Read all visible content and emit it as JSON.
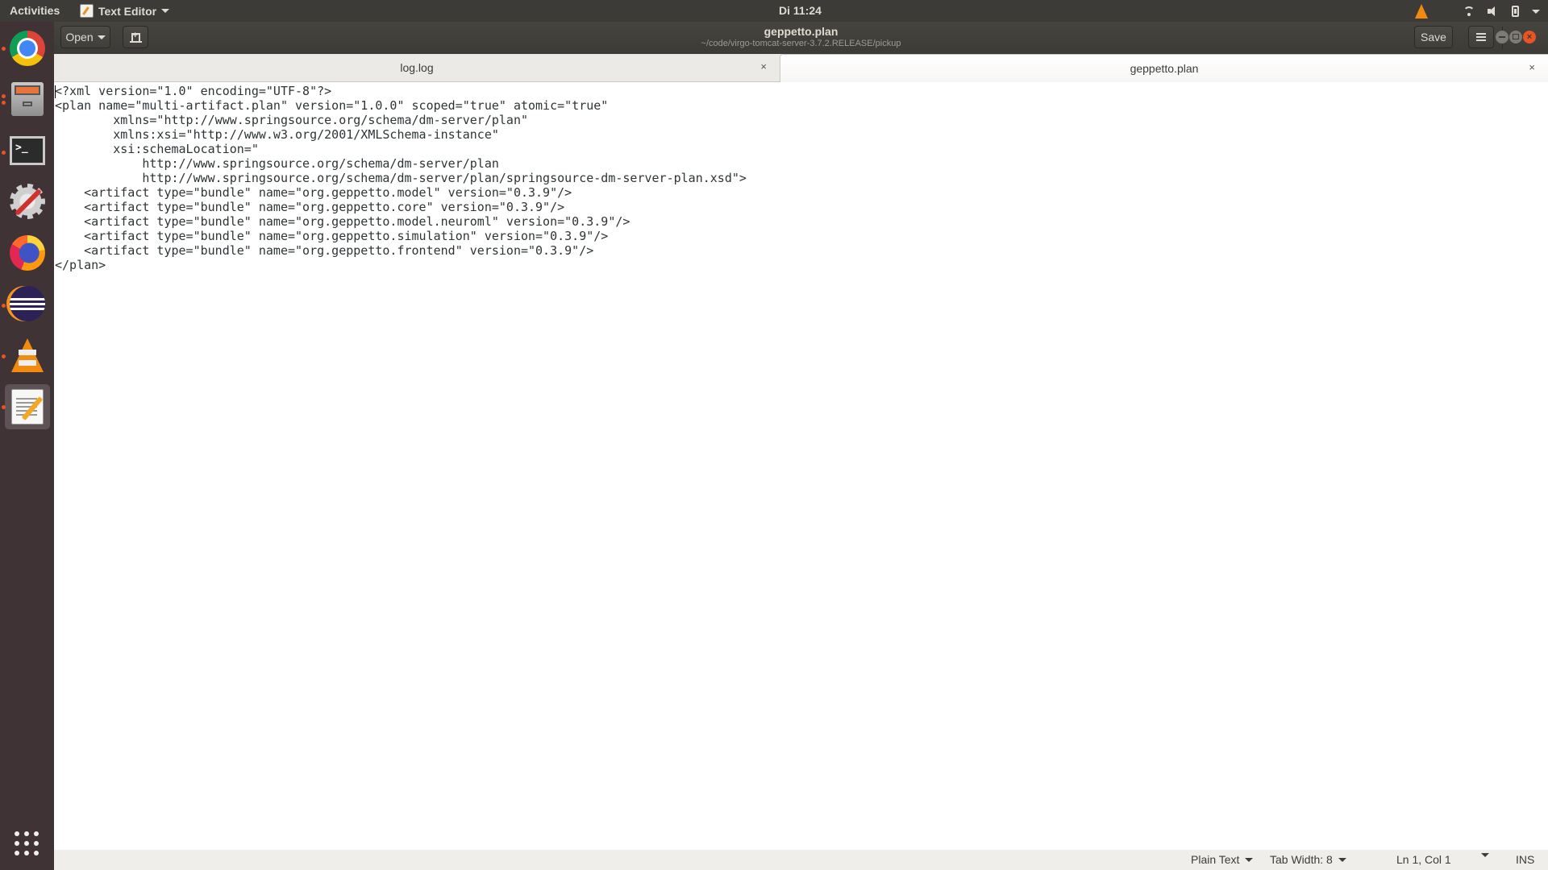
{
  "topbar": {
    "activities": "Activities",
    "app_name": "Text Editor",
    "clock": "Di 11:24",
    "tray_icons": [
      "vlc-icon",
      "wifi-icon",
      "volume-icon",
      "battery-icon",
      "system-menu-icon"
    ]
  },
  "dock": {
    "items": [
      {
        "name": "Google Chrome",
        "icon": "chrome-icon",
        "running": true
      },
      {
        "name": "Files",
        "icon": "files-icon",
        "running": true
      },
      {
        "name": "Terminal",
        "icon": "terminal-icon",
        "running": true
      },
      {
        "name": "System Tools",
        "icon": "system-tools-icon",
        "running": false
      },
      {
        "name": "Firefox",
        "icon": "firefox-icon",
        "running": false
      },
      {
        "name": "Eclipse",
        "icon": "eclipse-icon",
        "running": true
      },
      {
        "name": "VLC",
        "icon": "vlc-icon",
        "running": true
      },
      {
        "name": "Text Editor",
        "icon": "gedit-icon",
        "running": true,
        "active": true
      }
    ],
    "show_apps": "show-applications-icon",
    "terminal_glyph": ">_"
  },
  "headerbar": {
    "open_label": "Open",
    "title": "geppetto.plan",
    "subtitle": "~/code/virgo-tomcat-server-3.7.2.RELEASE/pickup",
    "save_label": "Save",
    "close_glyph": "×"
  },
  "tabs": [
    {
      "label": "log.log",
      "close": "×",
      "active": false
    },
    {
      "label": "geppetto.plan",
      "close": "×",
      "active": true
    }
  ],
  "editor": {
    "lines": [
      "<?xml version=\"1.0\" encoding=\"UTF-8\"?>",
      "<plan name=\"multi-artifact.plan\" version=\"1.0.0\" scoped=\"true\" atomic=\"true\"",
      "        xmlns=\"http://www.springsource.org/schema/dm-server/plan\"",
      "        xmlns:xsi=\"http://www.w3.org/2001/XMLSchema-instance\"",
      "        xsi:schemaLocation=\"",
      "            http://www.springsource.org/schema/dm-server/plan",
      "            http://www.springsource.org/schema/dm-server/plan/springsource-dm-server-plan.xsd\">",
      "    <artifact type=\"bundle\" name=\"org.geppetto.model\" version=\"0.3.9\"/>",
      "    <artifact type=\"bundle\" name=\"org.geppetto.core\" version=\"0.3.9\"/>",
      "    <artifact type=\"bundle\" name=\"org.geppetto.model.neuroml\" version=\"0.3.9\"/>",
      "    <artifact type=\"bundle\" name=\"org.geppetto.simulation\" version=\"0.3.9\"/>",
      "    <artifact type=\"bundle\" name=\"org.geppetto.frontend\" version=\"0.3.9\"/>",
      "</plan>"
    ]
  },
  "statusbar": {
    "language": "Plain Text",
    "tab_width": "Tab Width: 8",
    "position": "Ln 1, Col 1",
    "mode": "INS"
  }
}
